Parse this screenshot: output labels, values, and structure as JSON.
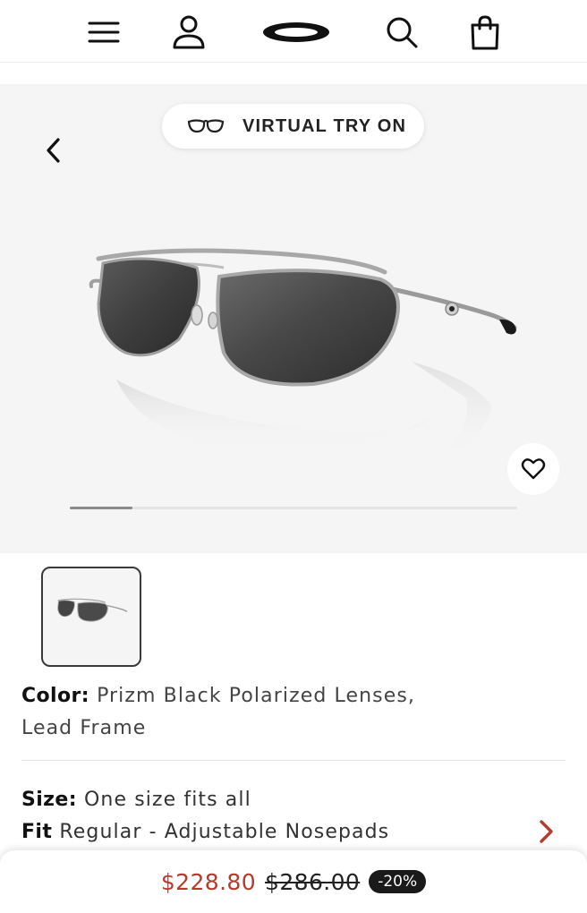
{
  "header": {
    "menu_icon": "hamburger-menu-icon",
    "account_icon": "user-icon",
    "logo": "oakley-ellipse-logo",
    "search_icon": "search-icon",
    "bag_icon": "shopping-bag-icon"
  },
  "gallery": {
    "virtual_try_on_label": "VIRTUAL TRY ON",
    "carousel_progress": 0.14
  },
  "product": {
    "color_label": "Color:",
    "color_value": "Prizm Black Polarized Lenses,",
    "color_value_line2": "Lead Frame",
    "size_label": "Size:",
    "size_value": "One size fits all",
    "fit_label": "Fit",
    "fit_value": "Regular - Adjustable Nosepads"
  },
  "price": {
    "sale": "$228.80",
    "original": "$286.00",
    "discount": "-20%"
  },
  "colors": {
    "sale_price": "#b73a2c",
    "accent_chevron": "#b73a2c",
    "badge_bg": "#1a1a1a"
  }
}
